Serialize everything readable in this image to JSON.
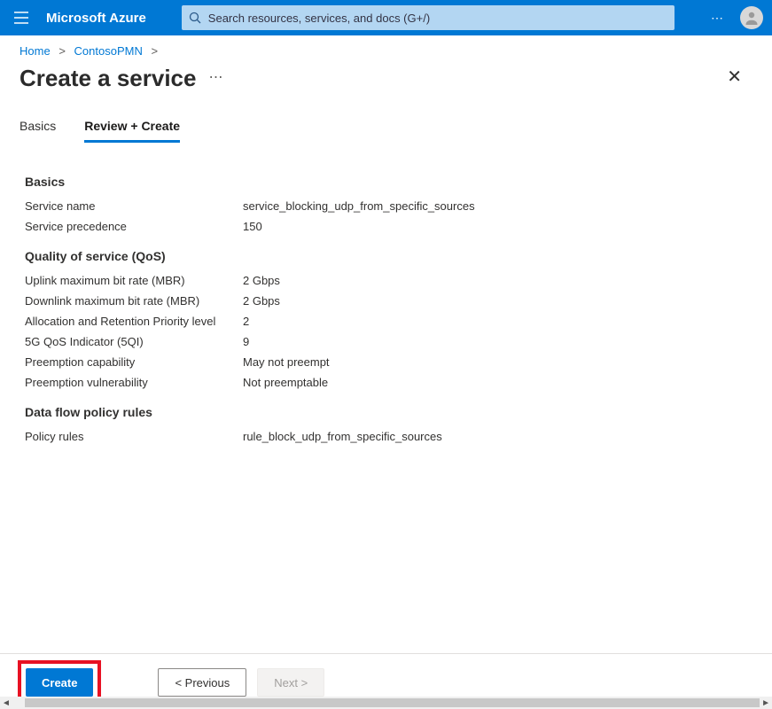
{
  "header": {
    "brand": "Microsoft Azure",
    "search_placeholder": "Search resources, services, and docs (G+/)"
  },
  "breadcrumb": {
    "items": [
      "Home",
      "ContosoPMN"
    ]
  },
  "page": {
    "title": "Create a service"
  },
  "tabs": [
    {
      "label": "Basics",
      "active": false
    },
    {
      "label": "Review + Create",
      "active": true
    }
  ],
  "sections": {
    "basics": {
      "title": "Basics",
      "service_name_label": "Service name",
      "service_name_value": "service_blocking_udp_from_specific_sources",
      "service_precedence_label": "Service precedence",
      "service_precedence_value": "150"
    },
    "qos": {
      "title": "Quality of service (QoS)",
      "uplink_label": "Uplink maximum bit rate (MBR)",
      "uplink_value": "2 Gbps",
      "downlink_label": "Downlink maximum bit rate (MBR)",
      "downlink_value": "2 Gbps",
      "arp_label": "Allocation and Retention Priority level",
      "arp_value": "2",
      "fivegqi_label": "5G QoS Indicator (5QI)",
      "fivegqi_value": "9",
      "preempt_cap_label": "Preemption capability",
      "preempt_cap_value": "May not preempt",
      "preempt_vuln_label": "Preemption vulnerability",
      "preempt_vuln_value": "Not preemptable"
    },
    "rules": {
      "title": "Data flow policy rules",
      "policy_rules_label": "Policy rules",
      "policy_rules_value": "rule_block_udp_from_specific_sources"
    }
  },
  "footer": {
    "create": "Create",
    "previous": "< Previous",
    "next": "Next >"
  }
}
